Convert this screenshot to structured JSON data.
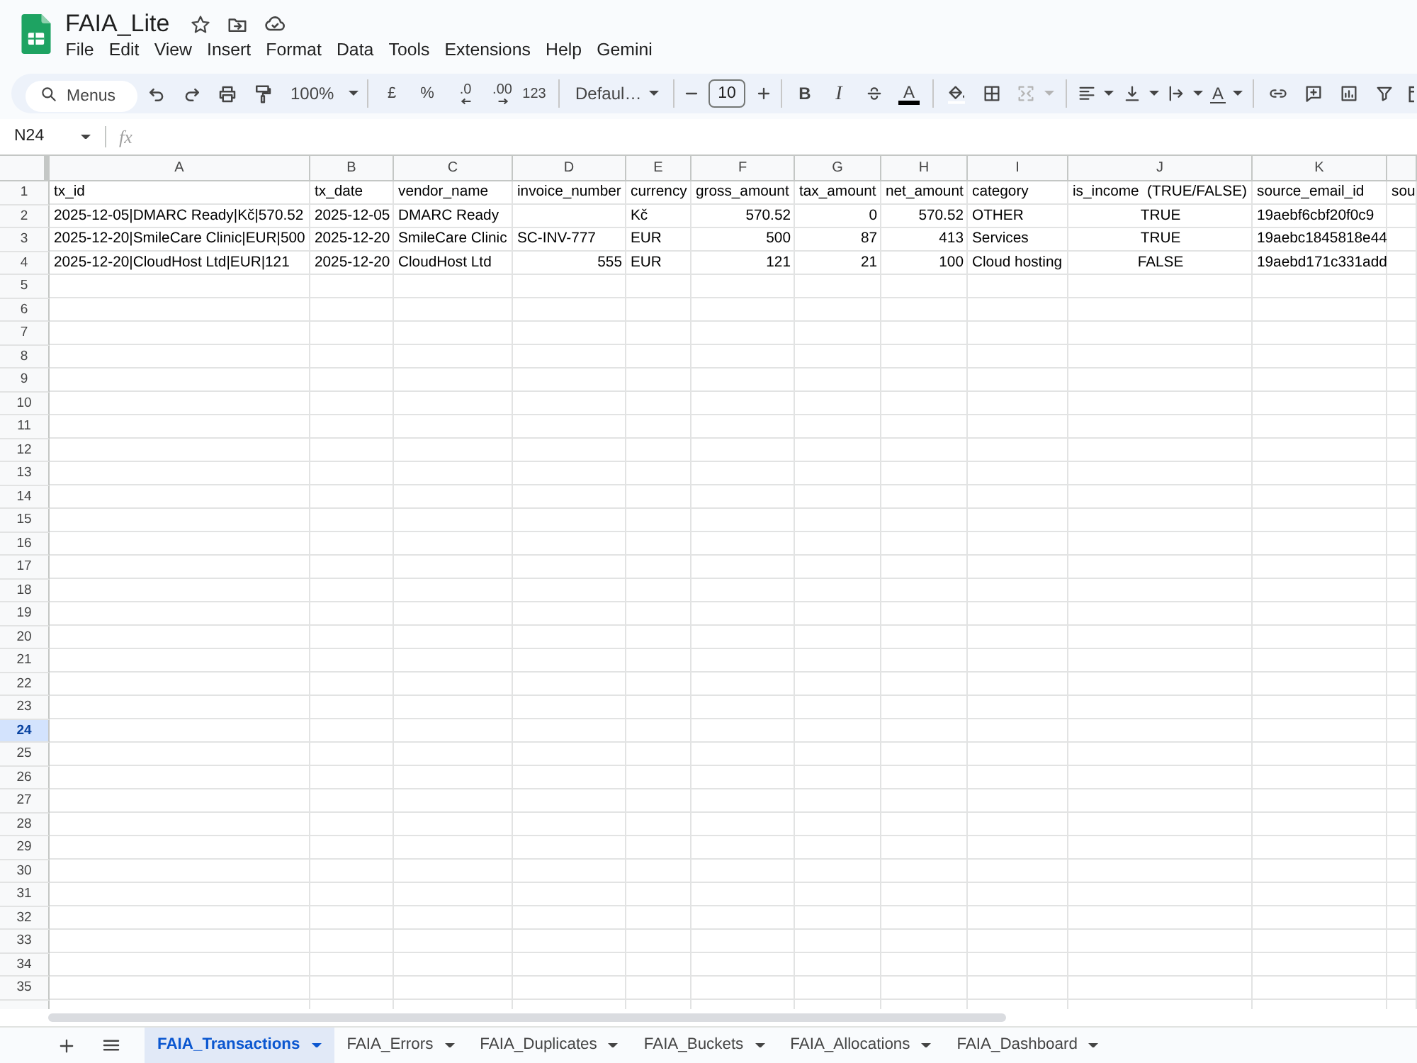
{
  "document": {
    "title": "FAIA_Lite",
    "starred": false
  },
  "menu": [
    "File",
    "Edit",
    "View",
    "Insert",
    "Format",
    "Data",
    "Tools",
    "Extensions",
    "Help",
    "Gemini"
  ],
  "toolbar": {
    "search": {
      "placeholder": "Menus"
    },
    "zoom": "100%",
    "number_formats": [
      {
        "label": "£",
        "kind": "currency"
      },
      {
        "label": "%",
        "kind": "percent"
      },
      {
        "label": ".0",
        "kind": "decimal_decrease"
      },
      {
        "label": ".00",
        "kind": "decimal_increase"
      },
      {
        "label": "123",
        "kind": "more"
      }
    ],
    "font": "Defaul…",
    "font_size": "10",
    "text_styles": [
      {
        "label": "B",
        "kind": "bold"
      },
      {
        "label": "I",
        "kind": "italic"
      }
    ],
    "text_color": "A",
    "merge": {
      "disabled": true
    },
    "rotation": "A"
  },
  "formula_bar": {
    "cell_reference": "N24",
    "function_label": "fx"
  },
  "grid": {
    "columns": [
      "A",
      "B",
      "C",
      "D",
      "E",
      "F",
      "G",
      "H",
      "I",
      "J",
      "K"
    ],
    "rows": [
      {
        "number": "1",
        "selected": false,
        "cells": [
          {
            "text": "tx_id",
            "kind": "text"
          },
          {
            "text": "tx_date",
            "kind": "text"
          },
          {
            "text": "vendor_name",
            "kind": "text"
          },
          {
            "text": "invoice_number",
            "kind": "text"
          },
          {
            "text": "currency",
            "kind": "text"
          },
          {
            "text": "gross_amount",
            "kind": "text"
          },
          {
            "text": "tax_amount",
            "kind": "text"
          },
          {
            "text": "net_amount",
            "kind": "text"
          },
          {
            "text": "category",
            "kind": "text"
          },
          {
            "text": "is_income  (TRUE/FALSE)",
            "kind": "text"
          },
          {
            "text": "source_email_id",
            "kind": "text"
          },
          {
            "text": "sou",
            "kind": "text"
          }
        ]
      },
      {
        "number": "2",
        "selected": false,
        "cells": [
          {
            "text": "2025-12-05|DMARC Ready|Kč|570.52",
            "kind": "text"
          },
          {
            "text": "2025-12-05",
            "kind": "text"
          },
          {
            "text": "DMARC Ready",
            "kind": "text"
          },
          null,
          {
            "text": "Kč",
            "kind": "text"
          },
          {
            "text": "570.52",
            "kind": "number"
          },
          {
            "text": "0",
            "kind": "number"
          },
          {
            "text": "570.52",
            "kind": "number"
          },
          {
            "text": "OTHER",
            "kind": "text"
          },
          {
            "text": "TRUE",
            "kind": "boolean"
          },
          {
            "text": "19aebf6cbf20f0c9",
            "kind": "text"
          }
        ]
      },
      {
        "number": "3",
        "selected": false,
        "cells": [
          {
            "text": "2025-12-20|SmileCare Clinic|EUR|500",
            "kind": "text"
          },
          {
            "text": "2025-12-20",
            "kind": "text"
          },
          {
            "text": "SmileCare Clinic",
            "kind": "text"
          },
          {
            "text": "SC-INV-777",
            "kind": "text"
          },
          {
            "text": "EUR",
            "kind": "text"
          },
          {
            "text": "500",
            "kind": "number"
          },
          {
            "text": "87",
            "kind": "number"
          },
          {
            "text": "413",
            "kind": "number"
          },
          {
            "text": "Services",
            "kind": "text"
          },
          {
            "text": "TRUE",
            "kind": "boolean"
          },
          {
            "text": "19aebc1845818e44",
            "kind": "text"
          }
        ]
      },
      {
        "number": "4",
        "selected": false,
        "cells": [
          {
            "text": "2025-12-20|CloudHost Ltd|EUR|121",
            "kind": "text"
          },
          {
            "text": "2025-12-20",
            "kind": "text"
          },
          {
            "text": "CloudHost Ltd",
            "kind": "text"
          },
          {
            "text": "555",
            "kind": "number"
          },
          {
            "text": "EUR",
            "kind": "text"
          },
          {
            "text": "121",
            "kind": "number"
          },
          {
            "text": "21",
            "kind": "number"
          },
          {
            "text": "100",
            "kind": "number"
          },
          {
            "text": "Cloud hosting",
            "kind": "text"
          },
          {
            "text": "FALSE",
            "kind": "boolean"
          },
          {
            "text": "19aebd171c331add",
            "kind": "text"
          }
        ]
      },
      {
        "number": "5",
        "selected": false
      },
      {
        "number": "6",
        "selected": false
      },
      {
        "number": "7",
        "selected": false
      },
      {
        "number": "8",
        "selected": false
      },
      {
        "number": "9",
        "selected": false
      },
      {
        "number": "10",
        "selected": false
      },
      {
        "number": "11",
        "selected": false
      },
      {
        "number": "12",
        "selected": false
      },
      {
        "number": "13",
        "selected": false
      },
      {
        "number": "14",
        "selected": false
      },
      {
        "number": "15",
        "selected": false
      },
      {
        "number": "16",
        "selected": false
      },
      {
        "number": "17",
        "selected": false
      },
      {
        "number": "18",
        "selected": false
      },
      {
        "number": "19",
        "selected": false
      },
      {
        "number": "20",
        "selected": false
      },
      {
        "number": "21",
        "selected": false
      },
      {
        "number": "22",
        "selected": false
      },
      {
        "number": "23",
        "selected": false
      },
      {
        "number": "24",
        "selected": true
      },
      {
        "number": "25",
        "selected": false
      },
      {
        "number": "26",
        "selected": false
      },
      {
        "number": "27",
        "selected": false
      },
      {
        "number": "28",
        "selected": false
      },
      {
        "number": "29",
        "selected": false
      },
      {
        "number": "30",
        "selected": false
      },
      {
        "number": "31",
        "selected": false
      },
      {
        "number": "32",
        "selected": false
      },
      {
        "number": "33",
        "selected": false
      },
      {
        "number": "34",
        "selected": false
      },
      {
        "number": "35",
        "selected": false
      }
    ]
  },
  "sheet_tabs": [
    {
      "label": "FAIA_Transactions",
      "selected": true
    },
    {
      "label": "FAIA_Errors",
      "selected": false
    },
    {
      "label": "FAIA_Duplicates",
      "selected": false
    },
    {
      "label": "FAIA_Buckets",
      "selected": false
    },
    {
      "label": "FAIA_Allocations",
      "selected": false
    },
    {
      "label": "FAIA_Dashboard",
      "selected": false
    }
  ]
}
